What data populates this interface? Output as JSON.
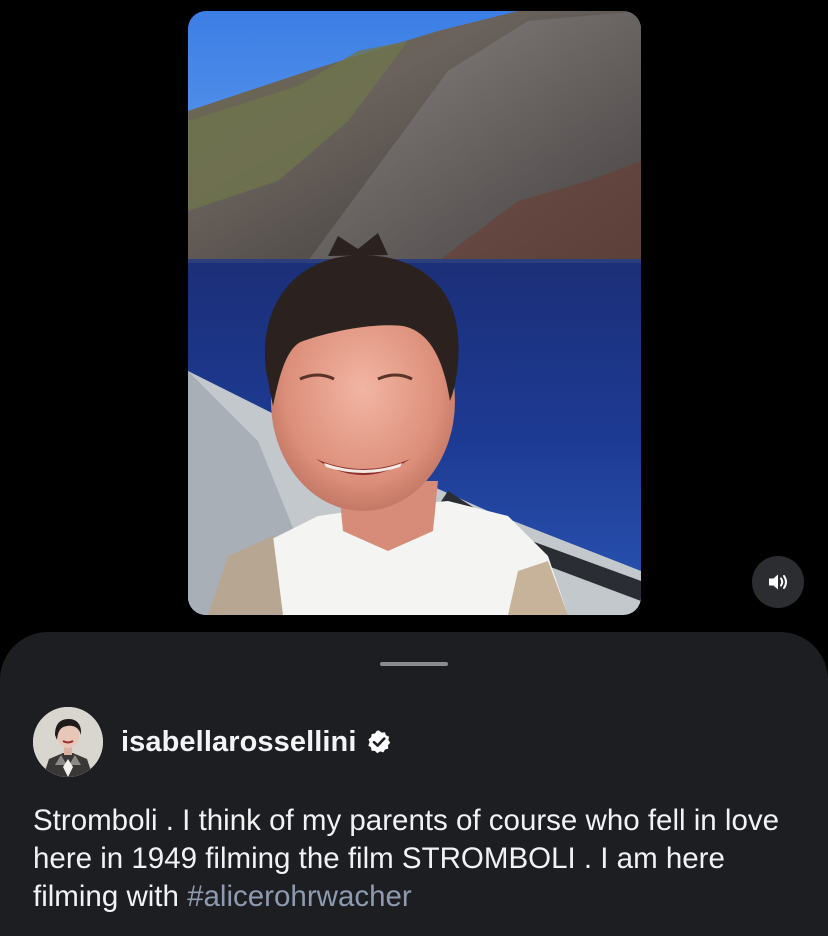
{
  "video": {
    "icon": "volume-icon",
    "colors": {
      "sky": "#3f7fe0",
      "sea": "#1a3a93",
      "mountain": "#5d5650",
      "boat": "#c8ccd1"
    }
  },
  "post": {
    "author": {
      "username": "isabellarossellini",
      "verified": true,
      "verified_icon": "verified-badge-icon",
      "avatar_icon": "profile-avatar"
    },
    "caption": {
      "text": "Stromboli . I think of my parents of course who fell in love here in 1949 filming the film STROMBOLI . I am here filming with ",
      "hashtag": "#alicerohrwacher"
    }
  },
  "colors": {
    "background": "#000000",
    "sheet": "#1c1e22",
    "text": "#f1f2f4",
    "hashtag": "#8e9aaf",
    "handle": "#8a8c91"
  }
}
